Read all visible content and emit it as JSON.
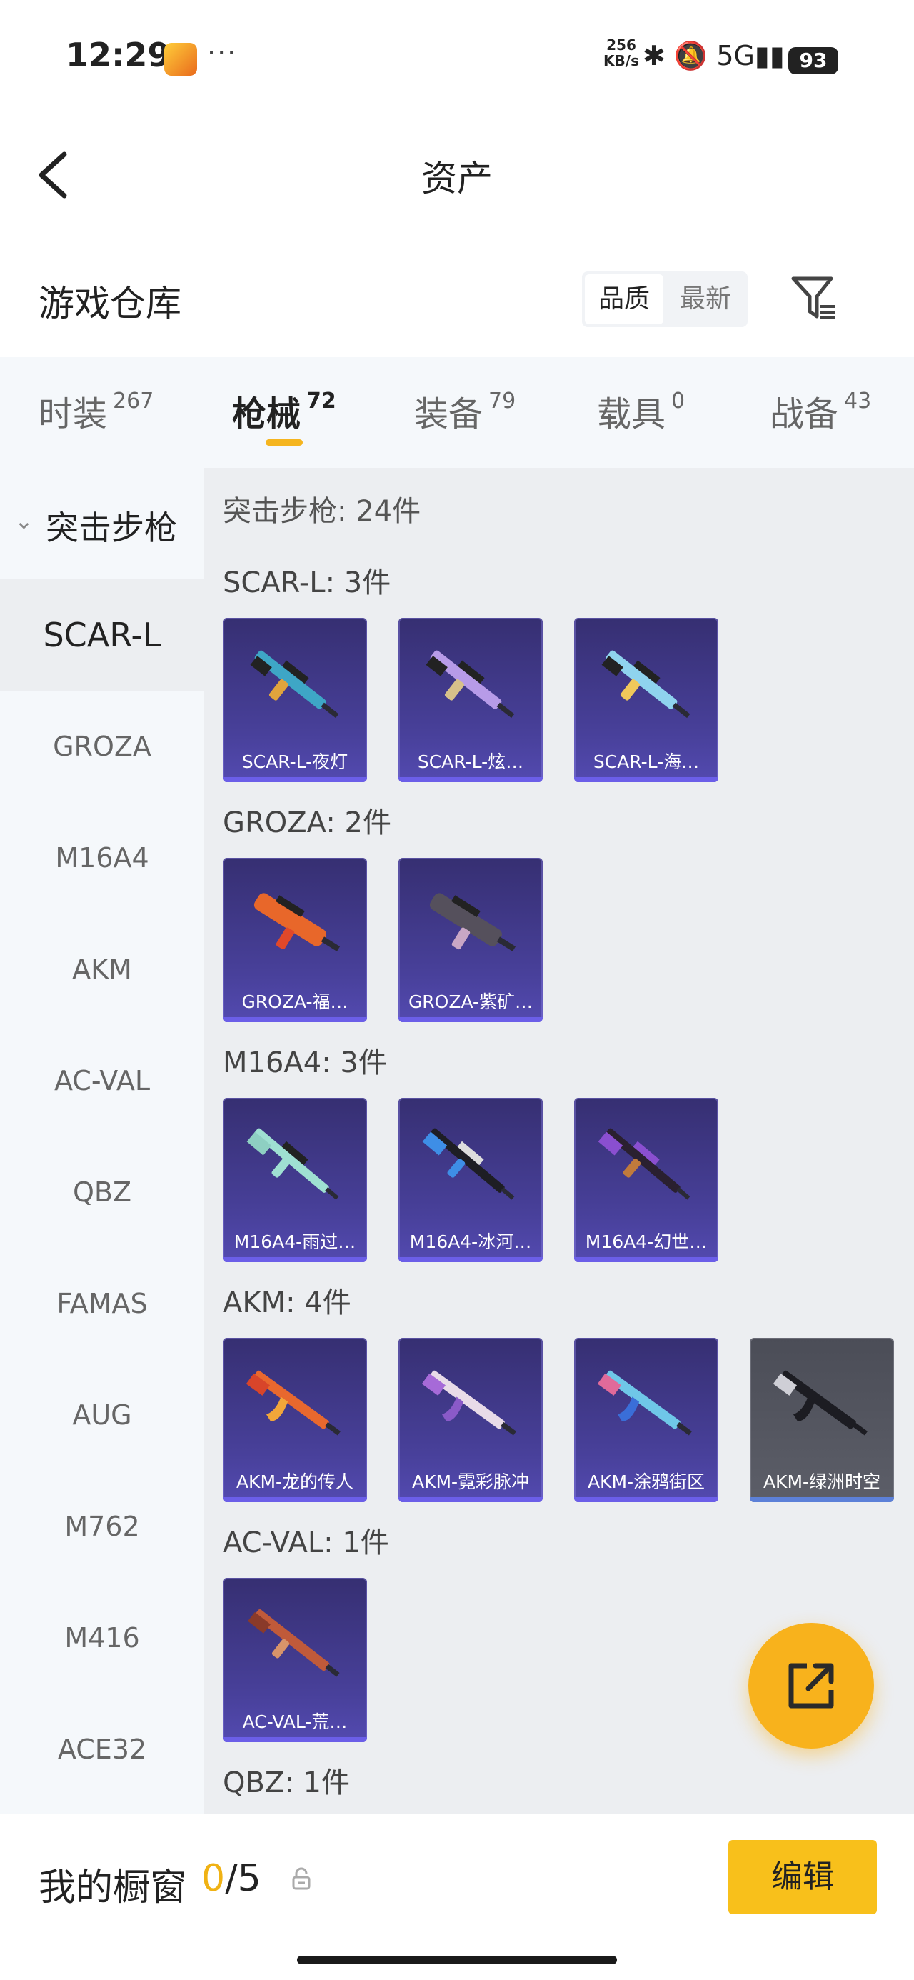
{
  "status_bar": {
    "time": "12:29",
    "more": "···",
    "speed_value": "256",
    "speed_unit": "KB/s",
    "icons": "✱ 🔕 5G▮▮",
    "battery": "93"
  },
  "header": {
    "title": "资产",
    "back_icon": "chevron-left-icon"
  },
  "warehouse": {
    "title": "游戏仓库",
    "sort_options": [
      "品质",
      "最新"
    ],
    "selected_sort": "品质",
    "filter_icon": "filter-icon"
  },
  "tabs": [
    {
      "label": "时装",
      "count": "267"
    },
    {
      "label": "枪械",
      "count": "72"
    },
    {
      "label": "装备",
      "count": "79"
    },
    {
      "label": "载具",
      "count": "0"
    },
    {
      "label": "战备",
      "count": "43"
    }
  ],
  "active_tab": "枪械",
  "sidebar": {
    "group": "突击步枪",
    "items": [
      "SCAR-L",
      "GROZA",
      "M16A4",
      "AKM",
      "AC-VAL",
      "QBZ",
      "FAMAS",
      "AUG",
      "M762",
      "M416",
      "ACE32"
    ],
    "active_item": "SCAR-L"
  },
  "content": {
    "header": "突击步枪: 24件",
    "groups": [
      {
        "title": "SCAR-L: 3件",
        "items": [
          {
            "name": "SCAR-L-夜灯"
          },
          {
            "name": "SCAR-L-炫…"
          },
          {
            "name": "SCAR-L-海…"
          }
        ]
      },
      {
        "title": "GROZA: 2件",
        "items": [
          {
            "name": "GROZA-福…"
          },
          {
            "name": "GROZA-紫矿…"
          }
        ]
      },
      {
        "title": "M16A4: 3件",
        "items": [
          {
            "name": "M16A4-雨过…"
          },
          {
            "name": "M16A4-冰河…"
          },
          {
            "name": "M16A4-幻世…"
          }
        ]
      },
      {
        "title": "AKM: 4件",
        "items": [
          {
            "name": "AKM-龙的传人"
          },
          {
            "name": "AKM-霓彩脉冲"
          },
          {
            "name": "AKM-涂鸦街区"
          },
          {
            "name": "AKM-绿洲时空"
          }
        ]
      },
      {
        "title": "AC-VAL: 1件",
        "items": [
          {
            "name": "AC-VAL-荒…"
          }
        ]
      },
      {
        "title": "QBZ: 1件",
        "items": []
      }
    ]
  },
  "fab_icon": "share-external-icon",
  "showcase": {
    "label": "我的橱窗",
    "current": "0",
    "total": "/5",
    "lock_icon": "lock-icon",
    "edit_label": "编辑"
  },
  "colors": {
    "accent": "#f8c01b",
    "card_purple": "#48409a",
    "active_underline": "#f5b51f"
  }
}
